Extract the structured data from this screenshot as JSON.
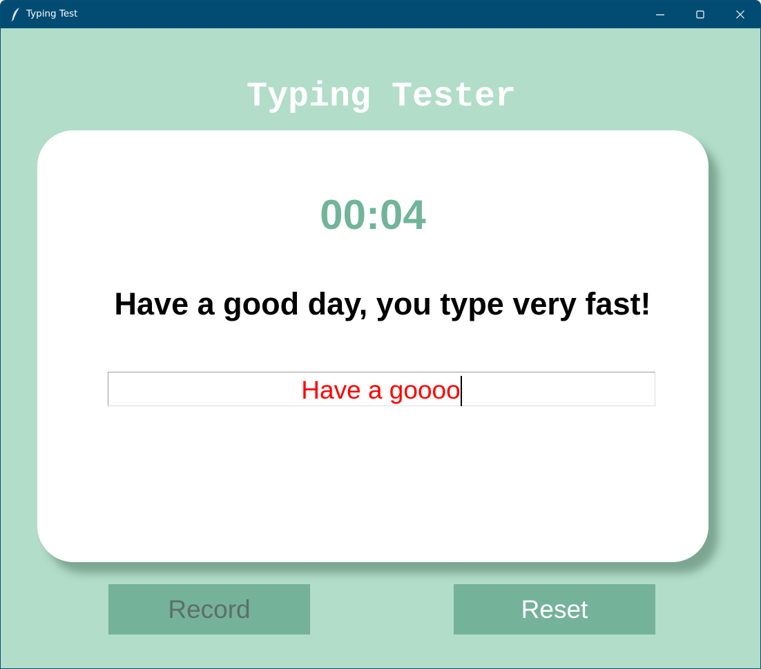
{
  "window": {
    "title": "Typing Test"
  },
  "app": {
    "title": "Typing Tester",
    "timer": "00:04",
    "target_sentence": "Have a good day, you type very fast!",
    "input_value": "Have a goooo"
  },
  "buttons": {
    "record_label": "Record",
    "reset_label": "Reset"
  },
  "colors": {
    "window_background": "#b1ddc9",
    "titlebar": "#024c74",
    "timer": "#71b49a",
    "button_background": "#75b29a",
    "typed_text_error": "#ff0000"
  }
}
